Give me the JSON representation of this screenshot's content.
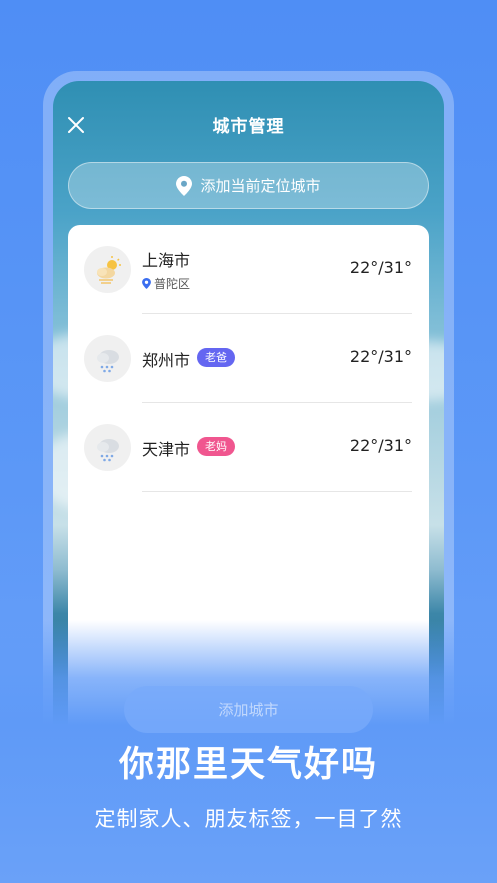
{
  "header": {
    "title": "城市管理"
  },
  "add_location_button": {
    "label": "添加当前定位城市"
  },
  "cities": [
    {
      "name": "上海市",
      "district": "普陀区",
      "tag": "",
      "temp": "22°/31°",
      "icon": "partly-sunny-icon"
    },
    {
      "name": "郑州市",
      "district": "",
      "tag": "老爸",
      "tag_color": "#6466f1",
      "temp": "22°/31°",
      "icon": "rain-cloud-icon"
    },
    {
      "name": "天津市",
      "district": "",
      "tag": "老妈",
      "tag_color": "#f0568f",
      "temp": "22°/31°",
      "icon": "rain-cloud-icon"
    }
  ],
  "add_city_button": {
    "label": "添加城市"
  },
  "promo": {
    "headline": "你那里天气好吗",
    "subline": "定制家人、朋友标签，一目了然"
  },
  "colors": {
    "accent": "#4f8ef5",
    "location_pin": "#3b6ef0"
  }
}
